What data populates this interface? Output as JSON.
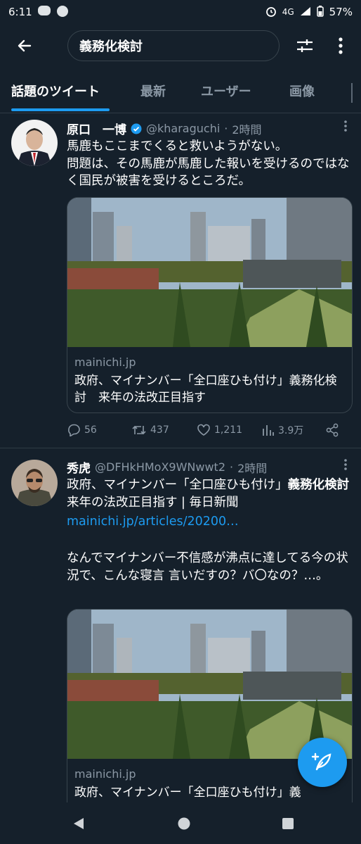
{
  "status": {
    "time": "6:11",
    "network": "4G",
    "battery": "57%"
  },
  "search": {
    "query": "義務化検討"
  },
  "tabs": [
    "話題のツイート",
    "最新",
    "ユーザー",
    "画像"
  ],
  "tweets": [
    {
      "name": "原口　一博",
      "handle": "@kharaguchi",
      "sep": "·",
      "time": "2時間",
      "text": "馬鹿もここまでくると救いようがない。\n問題は、その馬鹿が馬鹿した報いを受けるのではなく国民が被害を受けるところだ。",
      "card": {
        "domain": "mainichi.jp",
        "title": "政府、マイナンバー「全口座ひも付け」義務化検討　来年の法改正目指す"
      },
      "replies": "56",
      "retweets": "437",
      "likes": "1,211",
      "views": "3.9万"
    },
    {
      "name": "秀虎",
      "handle": "@DFHkHMoX9WNwwt2",
      "sep": "·",
      "time": "2時間",
      "text_pre": "政府、マイナンバー「全口座ひも付け」",
      "text_bold": "義務化検討",
      "text_post": "　来年の法改正目指す | 毎日新聞",
      "link": "mainichi.jp/articles/20200…",
      "text2": "なんでマイナンバー不信感が沸点に達してる今の状況で、こんな寝言 言いだすの？バ〇なの？…。",
      "card": {
        "domain": "mainichi.jp",
        "title": "政府、マイナンバー「全口座ひも付け」義"
      }
    }
  ],
  "colors": {
    "background": "#15202b",
    "accent": "#1d9bf0",
    "muted": "#8b98a5"
  }
}
